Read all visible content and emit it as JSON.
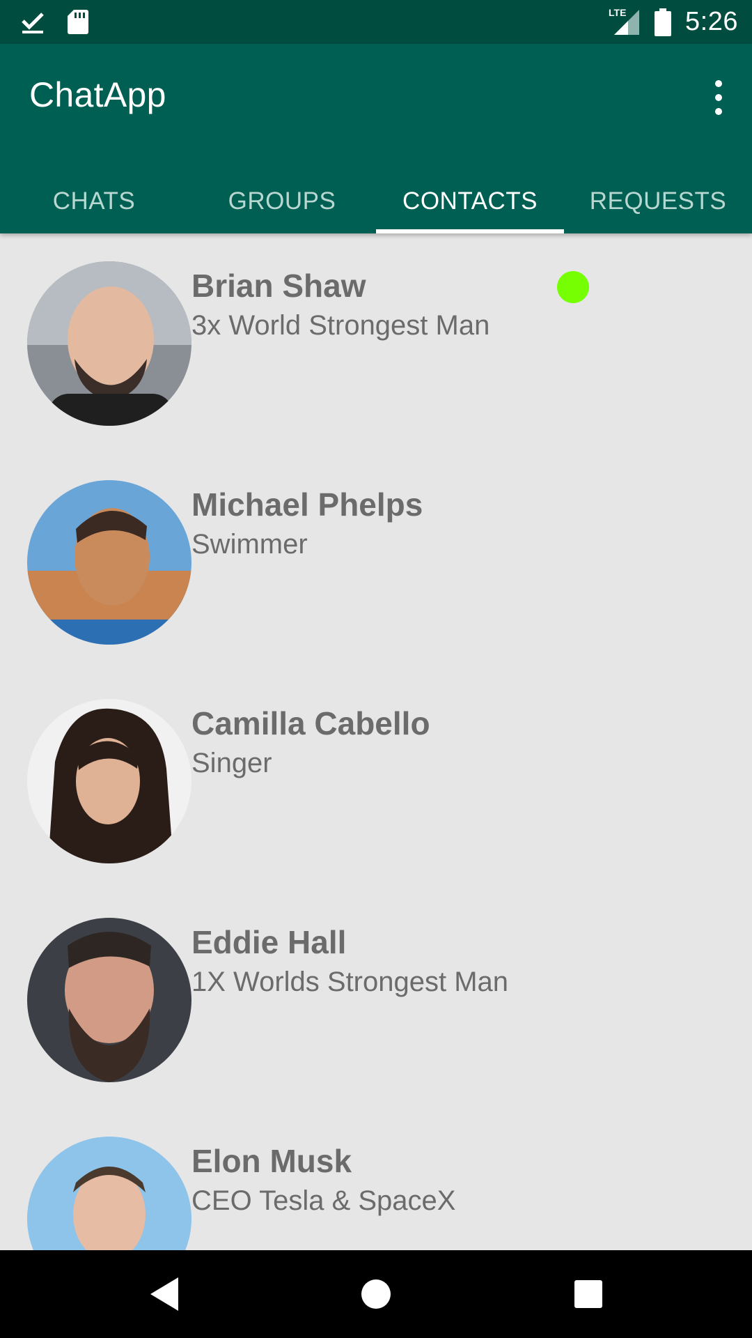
{
  "status_bar": {
    "time": "5:26",
    "network": "LTE",
    "icons": [
      "download-done-icon",
      "sd-card-icon",
      "signal-icon",
      "battery-icon"
    ]
  },
  "app_bar": {
    "title": "ChatApp",
    "menu_icon": "more-vert-icon",
    "color": "#005f53"
  },
  "tabs": [
    {
      "label": "CHATS"
    },
    {
      "label": "GROUPS"
    },
    {
      "label": "CONTACTS",
      "active": true
    },
    {
      "label": "REQUESTS"
    }
  ],
  "contacts": [
    {
      "name": "Brian Shaw",
      "status": "3x World Strongest Man",
      "online": true
    },
    {
      "name": "Michael Phelps",
      "status": "Swimmer"
    },
    {
      "name": "Camilla Cabello",
      "status": "Singer"
    },
    {
      "name": "Eddie Hall",
      "status": "1X Worlds Strongest Man"
    },
    {
      "name": "Elon Musk",
      "status": "CEO Tesla & SpaceX"
    }
  ],
  "colors": {
    "status_bar": "#004d40",
    "online": "#76ff03",
    "list_background": "#e6e6e6"
  },
  "nav_bar": {
    "buttons": [
      "back-icon",
      "home-icon",
      "recents-icon"
    ]
  }
}
